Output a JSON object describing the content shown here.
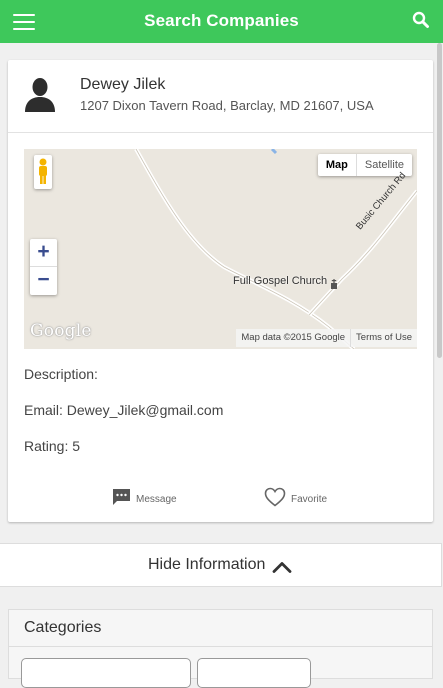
{
  "appbar": {
    "title": "Search Companies",
    "menu_icon": "hamburger-icon",
    "search_icon": "search-icon",
    "color": "#3ec85b"
  },
  "contact": {
    "name": "Dewey Jilek",
    "address": "1207 Dixon Tavern Road, Barclay, MD 21607, USA",
    "avatar_icon": "person-silhouette-icon"
  },
  "map": {
    "type_options": [
      "Map",
      "Satellite"
    ],
    "selected_type": "Map",
    "zoom_in": "+",
    "zoom_out": "−",
    "place_label": "Full Gospel Church",
    "road_label": "Busic Church Rd",
    "logo": "Google",
    "data_credit": "Map data ©2015 Google",
    "terms": "Terms of Use"
  },
  "details": {
    "description": "Description:",
    "email": "Email: Dewey_Jilek@gmail.com",
    "rating": "Rating: 5"
  },
  "actions": {
    "message": "Message",
    "favorite": "Favorite"
  },
  "toggle": {
    "label": "Hide Information"
  },
  "categories": {
    "title": "Categories"
  }
}
